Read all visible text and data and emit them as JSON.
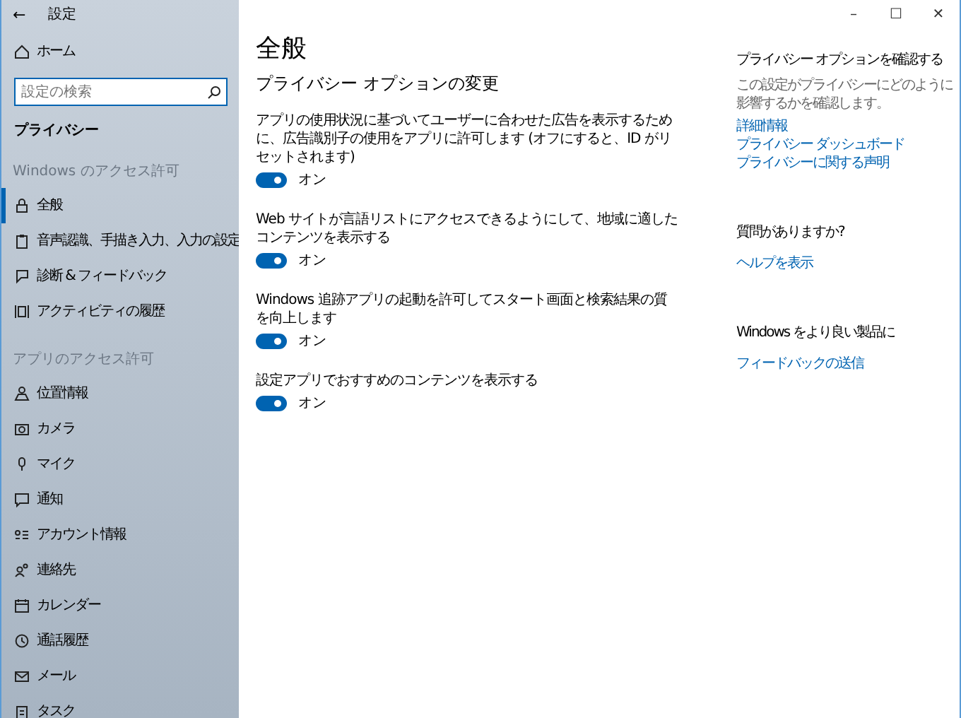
{
  "window": {
    "title": "設定",
    "back": "←",
    "controls": [
      "–",
      "☐",
      "✕"
    ]
  },
  "sidebar": {
    "home": "ホーム",
    "search": {
      "placeholder": "設定の検索"
    },
    "section_title": "プライバシー",
    "groups": [
      {
        "heading": "Windows のアクセス許可",
        "items": [
          {
            "label": "全般",
            "selected": true
          },
          {
            "label": "音声認識、手描き入力、入力の設定",
            "selected": false
          },
          {
            "label": "診断 & フィードバック",
            "selected": false
          },
          {
            "label": "アクティビティの履歴",
            "selected": false
          }
        ]
      },
      {
        "heading": "アプリのアクセス許可",
        "items": [
          {
            "label": "位置情報",
            "selected": false
          },
          {
            "label": "カメラ",
            "selected": false
          },
          {
            "label": "マイク",
            "selected": false
          },
          {
            "label": "通知",
            "selected": false
          },
          {
            "label": "アカウント情報",
            "selected": false
          },
          {
            "label": "連絡先",
            "selected": false
          },
          {
            "label": "カレンダー",
            "selected": false
          },
          {
            "label": "通話履歴",
            "selected": false
          },
          {
            "label": "メール",
            "selected": false
          },
          {
            "label": "タスク",
            "selected": false
          }
        ]
      }
    ]
  },
  "main": {
    "title": "全般",
    "subtitle": "プライバシー オプションの変更",
    "options": [
      {
        "text": "アプリの使用状況に基づいてユーザーに合わせた広告を表示するために、広告識別子の使用をアプリに許可します (オフにすると、ID がリセットされます)",
        "on": true,
        "state": "オン"
      },
      {
        "text": "Web サイトが言語リストにアクセスできるようにして、地域に適したコンテンツを表示する",
        "on": true,
        "state": "オン"
      },
      {
        "text": "Windows 追跡アプリの起動を許可してスタート画面と検索結果の質を向上します",
        "on": true,
        "state": "オン"
      },
      {
        "text": "設定アプリでおすすめのコンテンツを表示する",
        "on": true,
        "state": "オン"
      }
    ]
  },
  "aside": [
    {
      "heading": "プライバシー オプションを確認する",
      "description": "この設定がプライバシーにどのように影響するかを確認します。",
      "links": [
        "詳細情報",
        "プライバシー ダッシュボード",
        "プライバシーに関する声明"
      ]
    },
    {
      "heading": "質問がありますか?",
      "links": [
        "ヘルプを表示"
      ]
    },
    {
      "heading": "Windows をより良い製品に",
      "links": [
        "フィードバックの送信"
      ]
    }
  ]
}
